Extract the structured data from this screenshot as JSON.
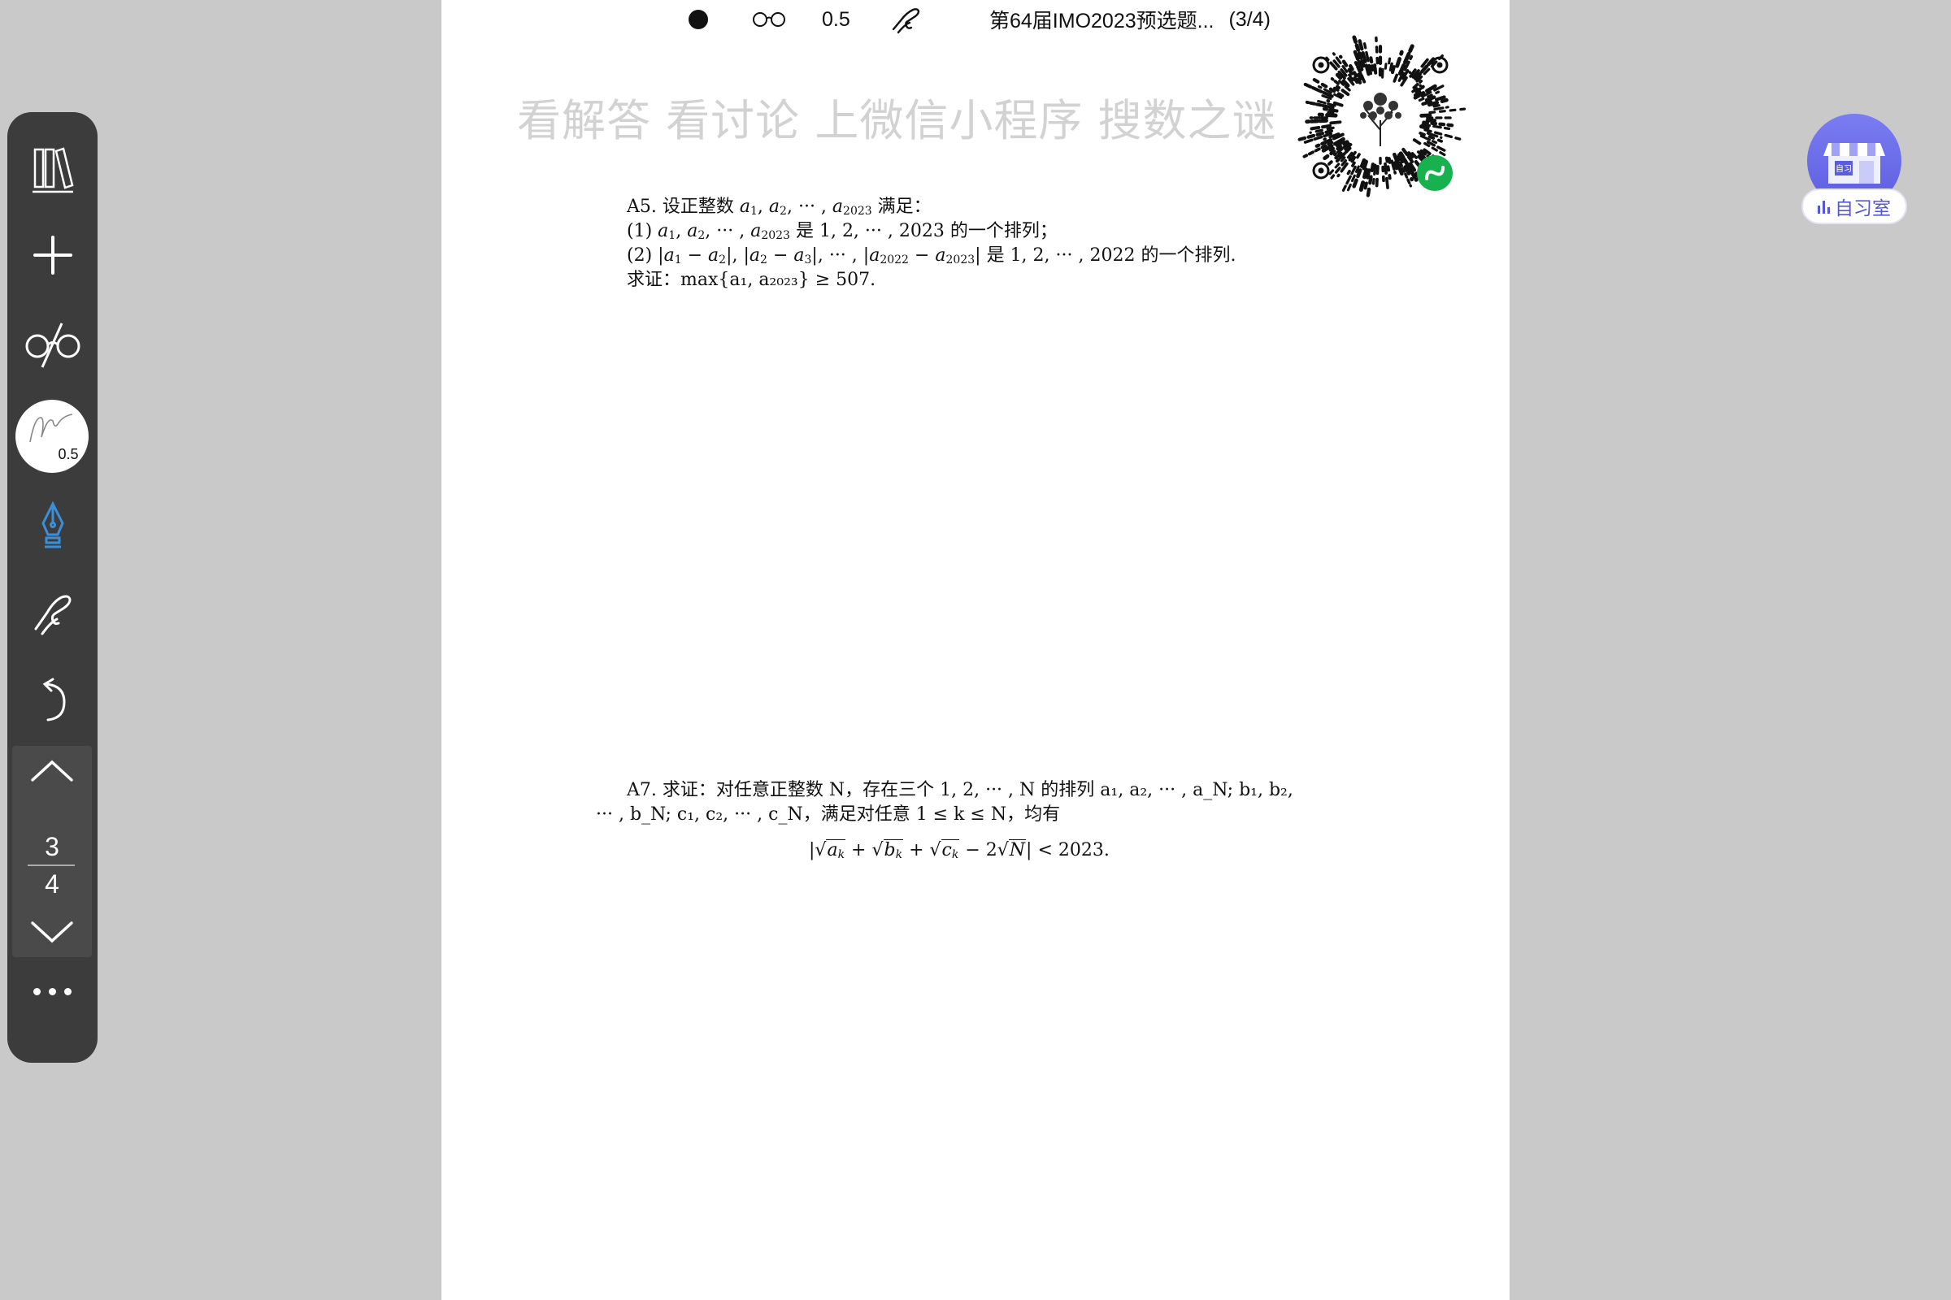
{
  "toolbar_top": {
    "pen_size": "0.5",
    "doc_title": "第64届IMO2023预选题...",
    "page_indicator": "(3/4)"
  },
  "watermark": "看解答 看讨论 上微信小程序 搜数之谜",
  "problems": {
    "a5": {
      "head": "A5. 设正整数 ",
      "seq": "a",
      "satisfy": " 满足：",
      "cond1_prefix": "(1) ",
      "cond1_suffix": " 是 1, 2, ··· , 2023 的一个排列；",
      "cond2_prefix": "(2) ",
      "cond2_suffix": " 是 1, 2, ··· , 2022 的一个排列.",
      "prove_prefix": "求证：",
      "prove_expr": "max{a₁, a₂₀₂₃} ≥ 507."
    },
    "a7": {
      "head": "A7. 求证：对任意正整数 N，存在三个 1, 2, ··· , N 的排列 ",
      "perm1": "a₁, a₂, ··· , a_N; b₁, b₂,",
      "line2": "··· , b_N; c₁, c₂, ··· , c_N，满足对任意 1 ≤ k ≤ N，均有",
      "rhs": " < 2023."
    }
  },
  "sidebar": {
    "signature_size": "0.5",
    "page_current": "3",
    "page_total": "4"
  },
  "study_room": {
    "label": "自习室",
    "sign_text": "自习"
  },
  "colors": {
    "sidebar_bg": "#3c3c3c",
    "active_pen": "#3a8fd8",
    "accent_purple": "#5356d6"
  }
}
